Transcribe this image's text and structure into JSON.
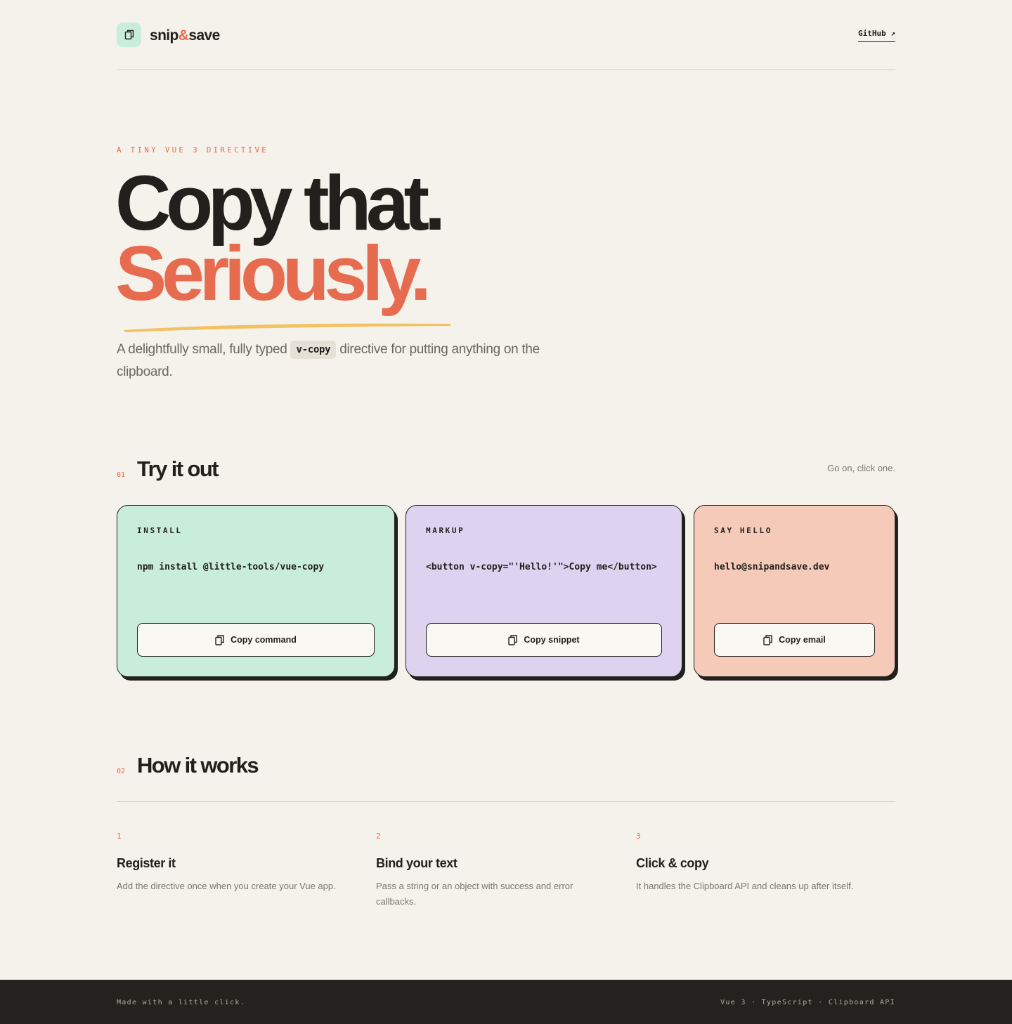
{
  "colors": {
    "background": "#f5f2ec",
    "ink": "#22201c",
    "accent": "#e76c4f",
    "highlight": "#f2c160",
    "card_install": "#c8eedb",
    "card_markup": "#ddd3f1",
    "card_hello": "#f6cab8",
    "footer": "#24221e"
  },
  "header": {
    "brand_part1": "snip",
    "brand_amp": "&",
    "brand_part2": "save",
    "logo_icon": "copy-icon",
    "github_label": "GitHub ↗"
  },
  "hero": {
    "eyebrow": "A TINY VUE 3 DIRECTIVE",
    "title_line1": "Copy that.",
    "title_line2": "Seriously.",
    "lead_before": "A delightfully small, fully typed ",
    "lead_code": "v-copy",
    "lead_after": " directive for putting anything on the clipboard."
  },
  "try_section": {
    "number": "01",
    "title": "Try it out",
    "hint": "Go on, click one.",
    "cards": [
      {
        "label": "INSTALL",
        "code": "npm install @little-tools/vue-copy",
        "button_label": "Copy command",
        "icon": "copy-icon"
      },
      {
        "label": "MARKUP",
        "code": "<button v-copy=\"'Hello!'\">Copy me</button>",
        "button_label": "Copy snippet",
        "icon": "copy-icon"
      },
      {
        "label": "SAY HELLO",
        "code": "hello@snipandsave.dev",
        "button_label": "Copy email",
        "icon": "copy-icon"
      }
    ]
  },
  "how_section": {
    "number": "02",
    "title": "How it works",
    "steps": [
      {
        "number": "1",
        "title": "Register it",
        "description": "Add the directive once when you create your Vue app."
      },
      {
        "number": "2",
        "title": "Bind your text",
        "description": "Pass a string or an object with success and error callbacks."
      },
      {
        "number": "3",
        "title": "Click & copy",
        "description": "It handles the Clipboard API and cleans up after itself."
      }
    ]
  },
  "footer": {
    "left": "Made with a little click.",
    "right": "Vue 3 · TypeScript · Clipboard API"
  }
}
